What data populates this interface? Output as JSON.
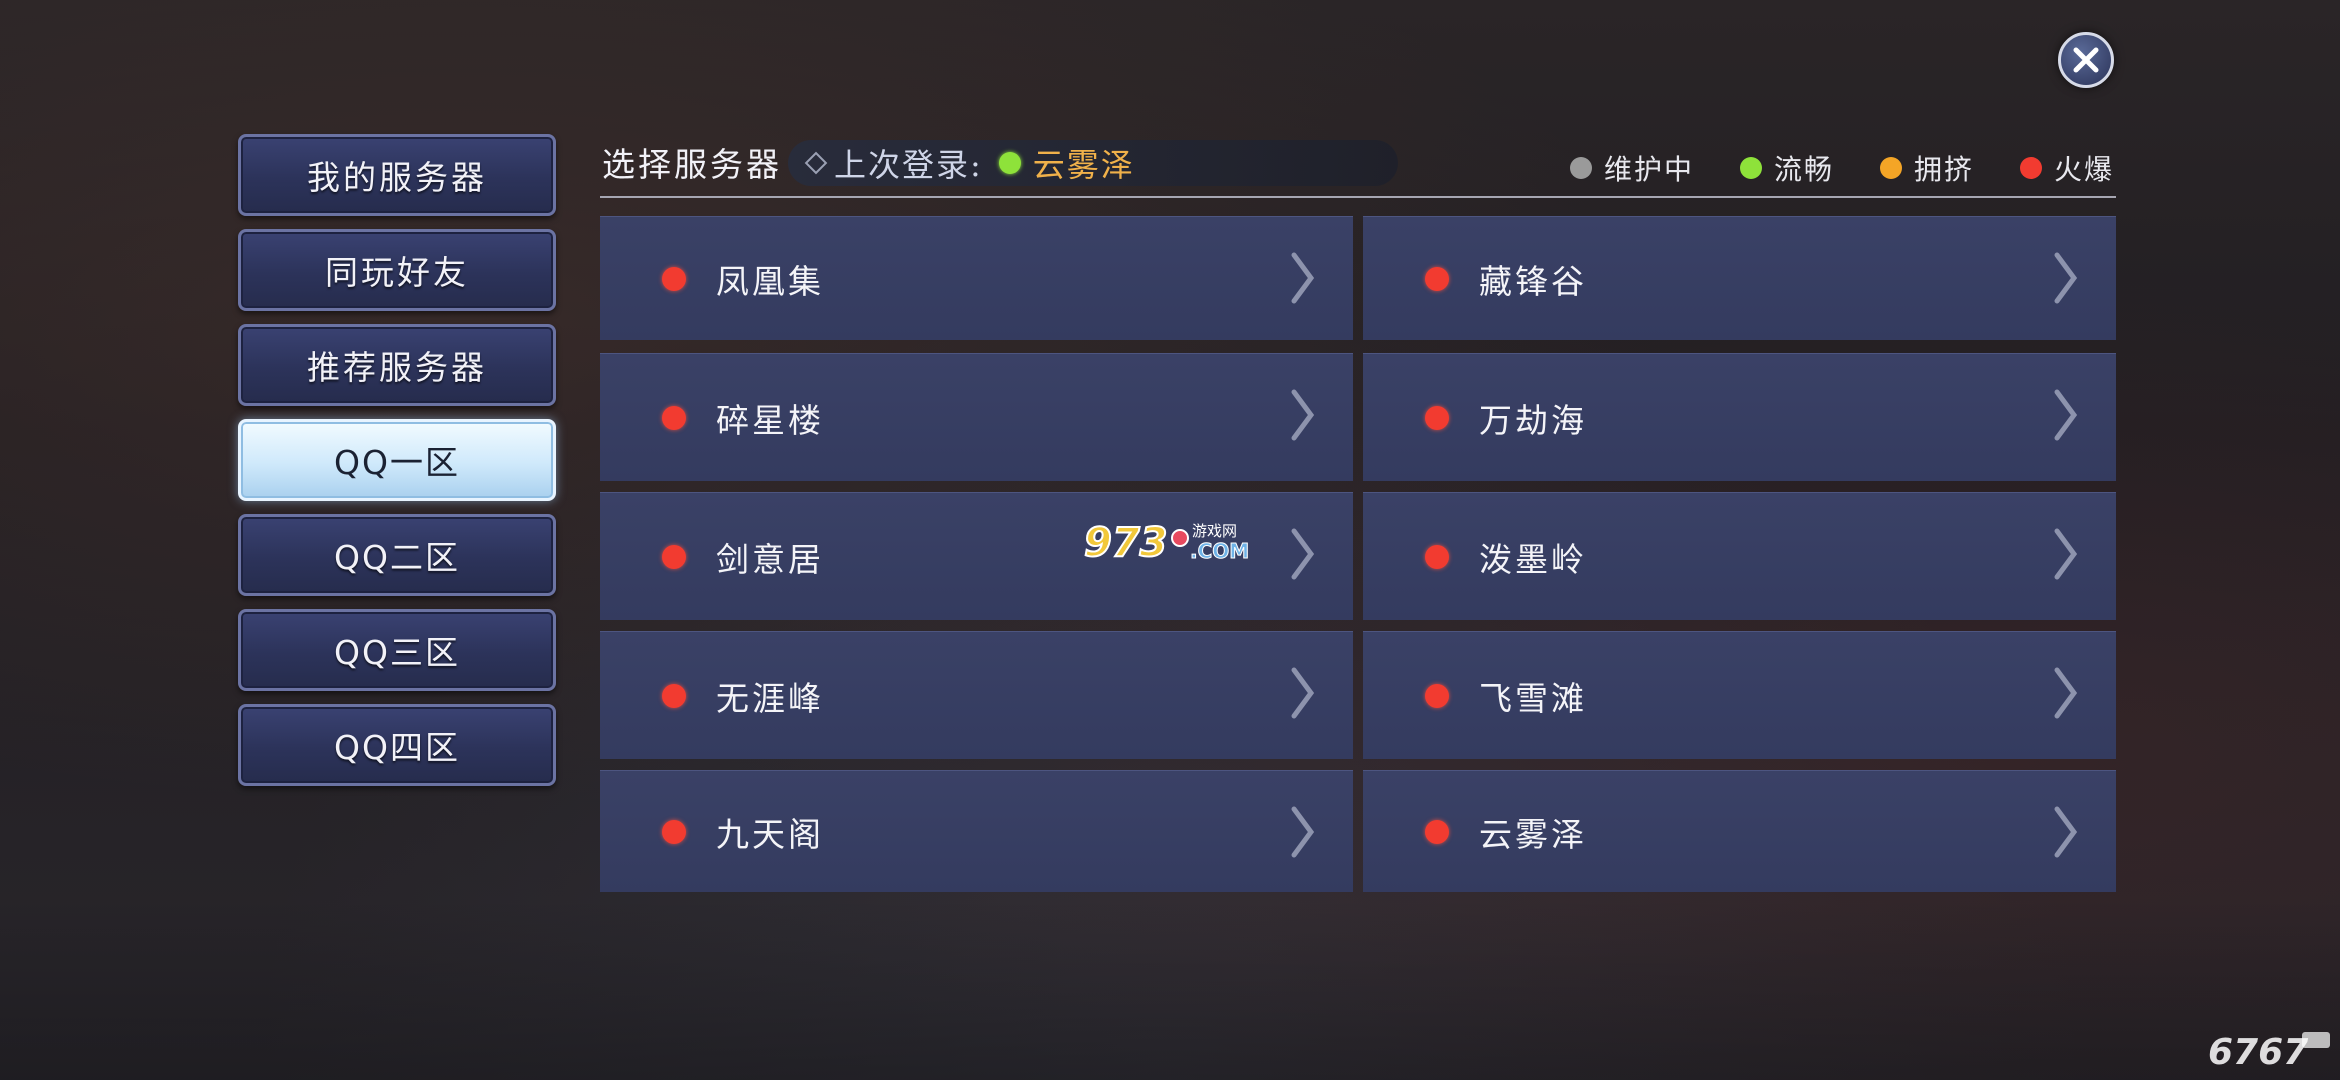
{
  "sidebar": {
    "items": [
      {
        "label": "我的服务器",
        "active": false
      },
      {
        "label": "同玩好友",
        "active": false
      },
      {
        "label": "推荐服务器",
        "active": false
      },
      {
        "label": "QQ一区",
        "active": true
      },
      {
        "label": "QQ二区",
        "active": false
      },
      {
        "label": "QQ三区",
        "active": false
      },
      {
        "label": "QQ四区",
        "active": false
      }
    ]
  },
  "header": {
    "title": "选择服务器",
    "last_login_label": "上次登录:",
    "last_login_server": "云雾泽",
    "last_login_status_color": "#8ee23a"
  },
  "legend": [
    {
      "label": "维护中",
      "color": "#9a9a9a"
    },
    {
      "label": "流畅",
      "color": "#8ee23a"
    },
    {
      "label": "拥挤",
      "color": "#f4a526"
    },
    {
      "label": "火爆",
      "color": "#f23b30"
    }
  ],
  "servers": [
    {
      "name": "凤凰集",
      "status_color": "#f23b30"
    },
    {
      "name": "藏锋谷",
      "status_color": "#f23b30"
    },
    {
      "name": "碎星楼",
      "status_color": "#f23b30"
    },
    {
      "name": "万劫海",
      "status_color": "#f23b30"
    },
    {
      "name": "剑意居",
      "status_color": "#f23b30"
    },
    {
      "name": "泼墨岭",
      "status_color": "#f23b30"
    },
    {
      "name": "无涯峰",
      "status_color": "#f23b30"
    },
    {
      "name": "飞雪滩",
      "status_color": "#f23b30"
    },
    {
      "name": "九天阁",
      "status_color": "#f23b30"
    },
    {
      "name": "云雾泽",
      "status_color": "#f23b30"
    }
  ],
  "watermarks": {
    "site_973": "973游戏网",
    "site_6767": "6767"
  }
}
